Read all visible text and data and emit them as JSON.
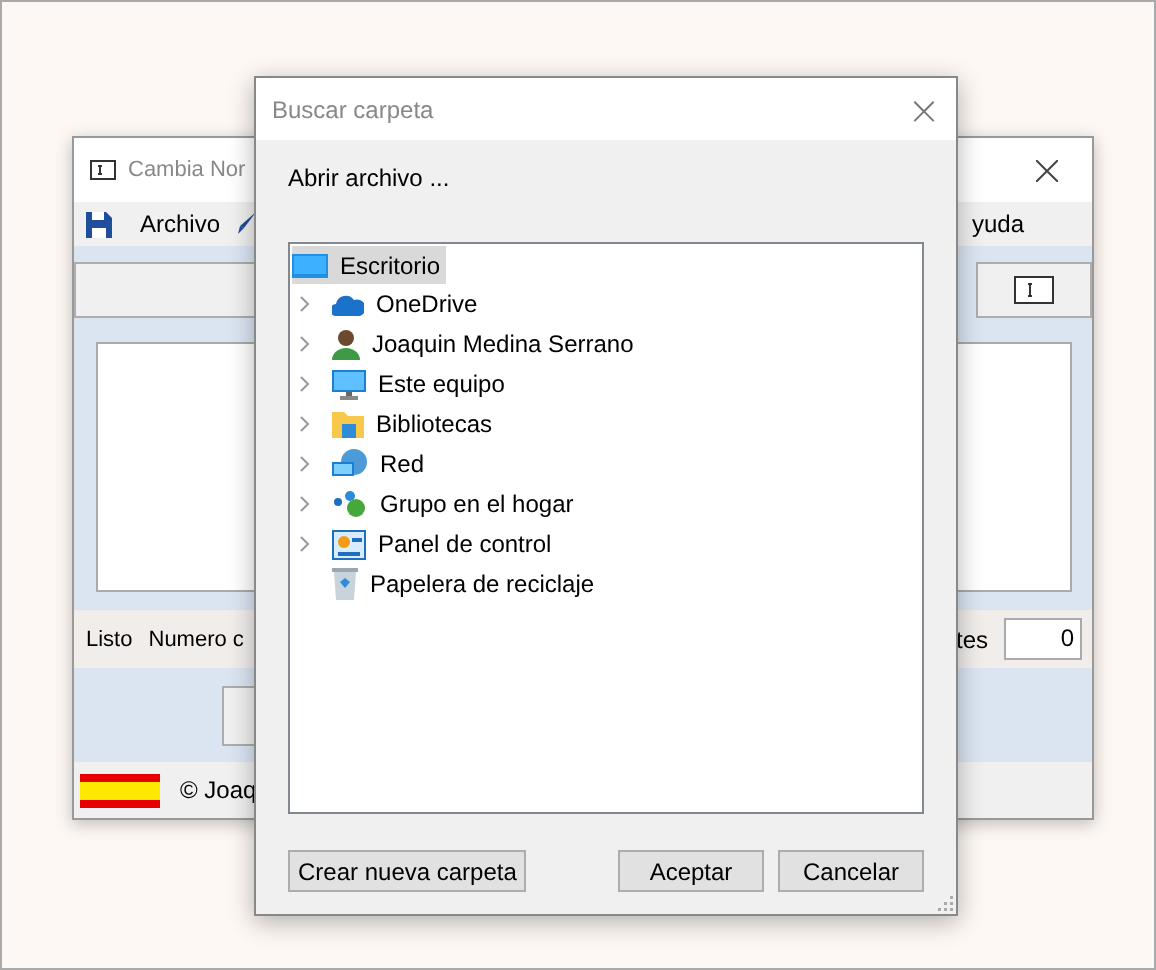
{
  "back_window": {
    "title": "Cambia Nor",
    "menu": [
      "Archivo",
      "yuda"
    ],
    "status": {
      "left": [
        "Listo",
        "Numero c"
      ],
      "right_label": "tes",
      "count": "0"
    },
    "footer": "© Joaq"
  },
  "dialog": {
    "title": "Buscar carpeta",
    "close": "×",
    "prompt": "Abrir archivo ...",
    "tree": {
      "label": "Escritorio",
      "kind": "desktop",
      "selected": true,
      "children": [
        {
          "label": "OneDrive",
          "kind": "cloud",
          "selected": false,
          "expandable": true
        },
        {
          "label": "Joaquin Medina Serrano",
          "kind": "user",
          "selected": false,
          "expandable": true
        },
        {
          "label": "Este equipo",
          "kind": "monitor",
          "selected": false,
          "expandable": true
        },
        {
          "label": "Bibliotecas",
          "kind": "folder",
          "selected": false,
          "expandable": true
        },
        {
          "label": "Red",
          "kind": "network",
          "selected": false,
          "expandable": true
        },
        {
          "label": "Grupo en el hogar",
          "kind": "group",
          "selected": false,
          "expandable": true
        },
        {
          "label": "Panel de control",
          "kind": "panel",
          "selected": false,
          "expandable": true
        },
        {
          "label": "Papelera de reciclaje",
          "kind": "bin",
          "selected": false,
          "expandable": false
        }
      ]
    },
    "buttons": [
      "Crear nueva carpeta",
      "Aceptar",
      "Cancelar"
    ]
  }
}
